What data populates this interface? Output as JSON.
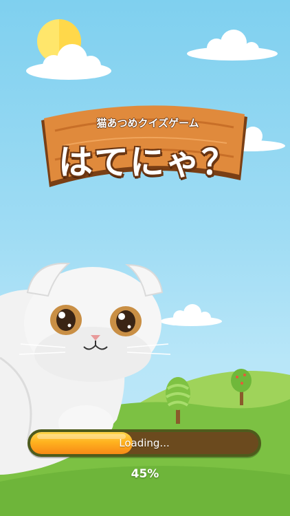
{
  "game": {
    "subtitle": "猫あつめクイズゲーム",
    "logo": "はてにゃ？"
  },
  "loading": {
    "label": "Loading...",
    "percent_text": "45%",
    "progress_fraction": 0.45
  },
  "colors": {
    "sky": "#8fd6f2",
    "board": "#e0853a",
    "grass": "#7cc143",
    "bar_fill": "#ffb21f"
  },
  "icons": [
    "sun-icon",
    "cloud-icon",
    "tree-icon",
    "cat-character"
  ]
}
